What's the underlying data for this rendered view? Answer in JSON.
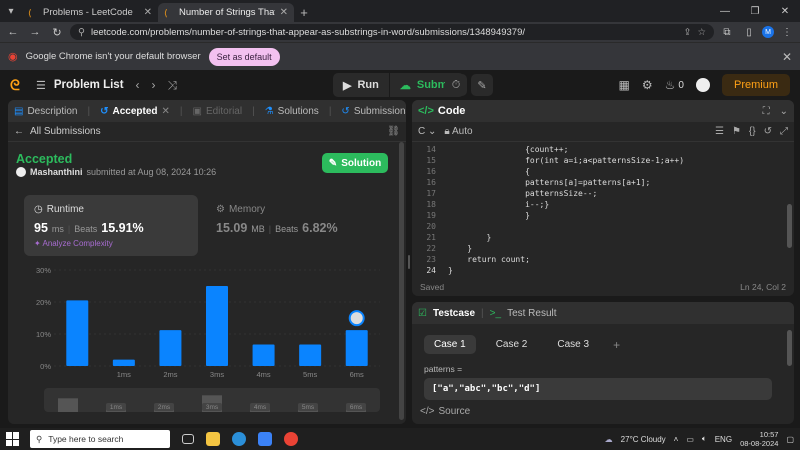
{
  "browser": {
    "tabs": [
      {
        "title": "Problems - LeetCode",
        "active": false
      },
      {
        "title": "Number of Strings That Appear",
        "active": true
      }
    ],
    "url": "leetcode.com/problems/number-of-strings-that-appear-as-substrings-in-word/submissions/1348949379/",
    "profile_initial": "M",
    "infobar": {
      "message": "Google Chrome isn't your default browser",
      "button": "Set as default"
    }
  },
  "header": {
    "problem_list": "Problem List",
    "run": "Run",
    "submit": "Submit",
    "notification_count": "0",
    "premium": "Premium"
  },
  "left": {
    "tabs": [
      {
        "label": "Description"
      },
      {
        "label": "Accepted"
      },
      {
        "label": "Editorial"
      },
      {
        "label": "Solutions"
      },
      {
        "label": "Submissions"
      }
    ],
    "all_submissions": "All Submissions",
    "status": "Accepted",
    "user": "Mashanthini",
    "submitted_text": "submitted at Aug 08, 2024 10:26",
    "solution_button": "Solution",
    "runtime": {
      "title": "Runtime",
      "value": "95",
      "unit": "ms",
      "beats_label": "Beats",
      "beats": "15.91%",
      "analyze": "Analyze Complexity"
    },
    "memory": {
      "title": "Memory",
      "value": "15.09",
      "unit": "MB",
      "beats_label": "Beats",
      "beats": "6.82%"
    }
  },
  "chart_data": {
    "type": "bar",
    "ylim": [
      0,
      30
    ],
    "yticks": [
      "30%",
      "20%",
      "10%",
      "0%"
    ],
    "tick_labels": [
      "1ms",
      "2ms",
      "3ms",
      "4ms",
      "5ms",
      "6ms"
    ],
    "values": [
      20.5,
      2,
      11.2,
      25,
      6.7,
      6.7,
      11.2
    ],
    "highlight_index": 6,
    "color": "#0a84ff"
  },
  "code": {
    "title": "Code",
    "language": "C",
    "mode": "Auto",
    "lines": [
      {
        "n": "14",
        "text": "                {count++;"
      },
      {
        "n": "15",
        "text": "                for(int a=i;a<patternsSize-1;a++)"
      },
      {
        "n": "16",
        "text": "                {"
      },
      {
        "n": "16",
        "text": "                patterns[a]=patterns[a+1];"
      },
      {
        "n": "17",
        "text": "                patternsSize--;"
      },
      {
        "n": "18",
        "text": "                i--;}"
      },
      {
        "n": "19",
        "text": "                }"
      },
      {
        "n": "20",
        "text": ""
      },
      {
        "n": "21",
        "text": "        }"
      },
      {
        "n": "22",
        "text": "    }"
      },
      {
        "n": "23",
        "text": "    return count;"
      },
      {
        "n": "24",
        "text": "}"
      }
    ],
    "saved": "Saved",
    "cursor": "Ln 24, Col 2"
  },
  "testcase": {
    "tab": "Testcase",
    "result_tab": "Test Result",
    "cases": [
      "Case 1",
      "Case 2",
      "Case 3"
    ],
    "param_label": "patterns =",
    "param_value": "[\"a\",\"abc\",\"bc\",\"d\"]",
    "source": "Source"
  },
  "taskbar": {
    "search_placeholder": "Type here to search",
    "weather": "27°C  Cloudy",
    "lang": "ENG",
    "time": "10:57",
    "date": "08-08-2024"
  }
}
